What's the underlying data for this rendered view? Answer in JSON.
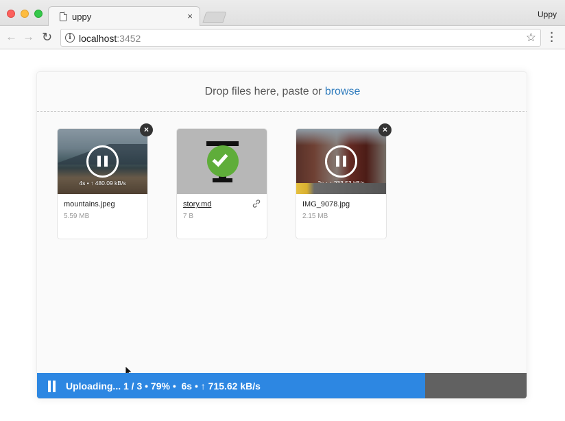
{
  "browser": {
    "tab_title": "uppy",
    "tab_close_glyph": "×",
    "profile_name": "Uppy",
    "url_host": "localhost",
    "url_port": ":3452",
    "icons": [
      "back-arrow-icon",
      "forward-arrow-icon",
      "reload-icon",
      "info-icon",
      "star-icon",
      "menu-dots-icon"
    ]
  },
  "dropzone": {
    "prompt": "Drop files here, paste or ",
    "browse_label": "browse"
  },
  "files": [
    {
      "name": "mountains.jpeg",
      "size": "5.59 MB",
      "state": "uploading",
      "stat": "4s  •  ↑ 480.09 kB/s",
      "remove_glyph": "×"
    },
    {
      "name": "story.md",
      "size": "7 B",
      "state": "complete"
    },
    {
      "name": "IMG_9078.jpg",
      "size": "2.15 MB",
      "state": "uploading",
      "stat": "2s  •  ↑ 233.53 kB/s",
      "remove_glyph": "×"
    }
  ],
  "status": {
    "text": "Uploading... 1 / 3 • 79% •  6s • ↑ 715.62 kB/s",
    "progress_percent": 79,
    "colors": {
      "fill": "#2d87e2",
      "track": "#616161"
    }
  }
}
